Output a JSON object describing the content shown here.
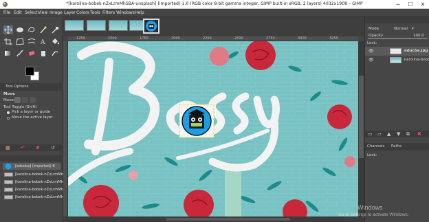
{
  "window": {
    "title": "*[karolina-bobek-nZxLrmMhSBA-unsplash] (imported)-1.0 (RGB color 8-bit gamma integer, GIMP built-in sRGB, 2 layers) 4032x1908 – GIMP",
    "minimize": "─",
    "maximize": "☐",
    "close": "✕"
  },
  "menu": [
    "File",
    "Edit",
    "Select",
    "View",
    "Image",
    "Layer",
    "Colors",
    "Tools",
    "Filters",
    "Windows",
    "Help"
  ],
  "tool_options": {
    "tab_label": "Tool Options",
    "title": "Move",
    "move_label": "Move:",
    "toggle_label": "Tool Toggle (Shift)",
    "option1": "Pick a layer or guide",
    "option2": "Move the active layer"
  },
  "images_list": {
    "items": [
      "[educba] (imported)-8",
      "[karolina-bobek-nZxLrmMhS",
      "[karolina-bobek-nZxLrmMhS",
      "[karolina-bobek-nZxLrmMhS",
      "[karolina-bobek-nZxLrmMhS"
    ]
  },
  "ruler": {
    "ticks": [
      "1250",
      "1500",
      "1750",
      "2000",
      "2250",
      "2500",
      "2750",
      "3000",
      "3250"
    ]
  },
  "layers": {
    "mode_label": "Mode",
    "mode_value": "Normal",
    "opacity_label": "Opacity",
    "opacity_value": "100.0",
    "lock_label": "Lock:",
    "items": [
      {
        "name": "educba.jpg"
      },
      {
        "name": "karolina-bobek"
      }
    ]
  },
  "channels": {
    "tab_channels": "Channels",
    "tab_paths": "Paths",
    "lock_label": "Lock:"
  },
  "watermark": {
    "line1": "Windows",
    "line2": "Go to Settings to activate Windows."
  },
  "canvas": {
    "word": "Bossy"
  },
  "colors": {
    "wall": "#79c2c3",
    "lettering": "#f3f3f3",
    "rose": "#c8283a",
    "leaf": "#1c8c8a",
    "logo_blue": "#1a9ee8"
  },
  "icons": [
    "gimp-app-icon",
    "move-tool-icon",
    "eye-icon",
    "chain-icon",
    "scroll-arrow-icon"
  ]
}
